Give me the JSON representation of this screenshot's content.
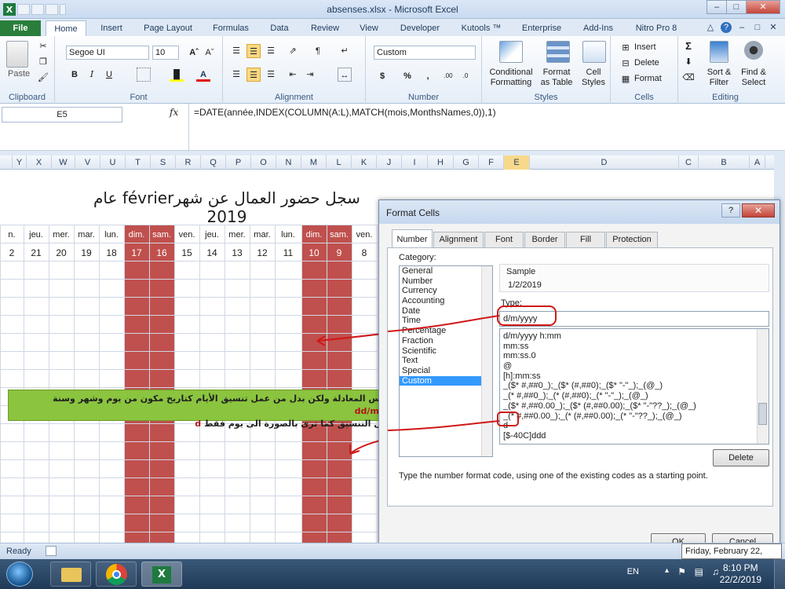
{
  "window": {
    "title": "absenses.xlsx  -  Microsoft Excel",
    "controls": [
      "–",
      "□",
      "✕"
    ]
  },
  "tabs": [
    "File",
    "Home",
    "Insert",
    "Page Layout",
    "Formulas",
    "Data",
    "Review",
    "View",
    "Developer",
    "Kutools ™",
    "Enterprise",
    "Add-Ins",
    "Nitro Pro 8"
  ],
  "ribbon": {
    "clipboard": {
      "paste": "Paste",
      "label": "Clipboard"
    },
    "font": {
      "name": "Segoe UI",
      "size": "10",
      "label": "Font",
      "bold": "B",
      "italic": "I",
      "underline": "U"
    },
    "alignment": {
      "label": "Alignment"
    },
    "number": {
      "format": "Custom",
      "label": "Number",
      "currency": "$",
      "percent": "%",
      "comma": ","
    },
    "styles": {
      "conditional": "Conditional\nFormatting",
      "format_table": "Format\nas Table",
      "cell_styles": "Cell\nStyles",
      "label": "Styles"
    },
    "cells": {
      "insert": "Insert",
      "delete": "Delete",
      "format": "Format",
      "label": "Cells"
    },
    "editing": {
      "sort": "Sort &\nFilter",
      "find": "Find &\nSelect",
      "label": "Editing",
      "sigma": "Σ"
    }
  },
  "formula_bar": {
    "name_box": "E5",
    "fx": "fx",
    "formula": "=DATE(année,INDEX(COLUMN(A:L),MATCH(mois,MonthsNames,0)),1)"
  },
  "columns": [
    "Y",
    "X",
    "W",
    "V",
    "U",
    "T",
    "S",
    "R",
    "Q",
    "P",
    "O",
    "N",
    "M",
    "L",
    "K",
    "J",
    "I",
    "H",
    "G",
    "F",
    "E",
    "D",
    "C",
    "B",
    "A"
  ],
  "sheet": {
    "title": "سجل حضور العمال عن شهرfévrier عام 2019",
    "days": [
      "n.",
      "jeu.",
      "mer.",
      "mar.",
      "lun.",
      "dim.",
      "sam.",
      "ven.",
      "jeu.",
      "mer.",
      "mar.",
      "lun.",
      "dim.",
      "sam.",
      "ven."
    ],
    "numbers": [
      "2",
      "21",
      "20",
      "19",
      "18",
      "17",
      "16",
      "15",
      "14",
      "13",
      "12",
      "11",
      "10",
      "9",
      "8"
    ]
  },
  "annotation": {
    "line1_prefix": "تعتبر نفس المعادلة ولكن بدل من عمل تنسيق الأيام كتاريخ مكون من يوم وشهر وسنة",
    "line1_code": "dd/mm/yyyy",
    "line2_prefix": "قام بعمل التنسيق كما ترى بالصورة الى يوم فقط",
    "line2_code": "d"
  },
  "dialog": {
    "title": "Format Cells",
    "help": "?",
    "close": "✕",
    "tabs": [
      "Number",
      "Alignment",
      "Font",
      "Border",
      "Fill",
      "Protection"
    ],
    "category_label": "Category:",
    "categories": [
      "General",
      "Number",
      "Currency",
      "Accounting",
      "Date",
      "Time",
      "Percentage",
      "Fraction",
      "Scientific",
      "Text",
      "Special",
      "Custom"
    ],
    "selected_category": "Custom",
    "sample_label": "Sample",
    "sample_value": "1/2/2019",
    "type_label": "Type:",
    "type_value": "d/m/yyyy",
    "type_list": [
      "d/m/yyyy h:mm",
      "mm:ss",
      "mm:ss.0",
      "@",
      "[h]:mm:ss",
      "_($* #,##0_);_($* (#,##0);_($* \"-\"_);_(@_)",
      "_(* #,##0_);_(* (#,##0);_(* \"-\"_);_(@_)",
      "_($* #,##0.00_);_($* (#,##0.00);_($* \"-\"??_);_(@_)",
      "_(* #,##0.00_);_(* (#,##0.00);_(* \"-\"??_);_(@_)",
      "d",
      "[$-40C]ddd"
    ],
    "delete_button": "Delete",
    "hint": "Type the number format code, using one of the existing codes as a starting point.",
    "ok_button": "OK",
    "cancel_button": "Cancel"
  },
  "status": {
    "ready": "Ready"
  },
  "tooltip": "Friday, February 22, 2019",
  "taskbar": {
    "lang": "EN",
    "time": "8:10 PM",
    "date": "22/2/2019"
  },
  "colors": {
    "weekend": "#c0504d",
    "annotation_bg": "#8bc43f",
    "arrow": "#d01818",
    "file_tab": "#2a7e3c"
  }
}
